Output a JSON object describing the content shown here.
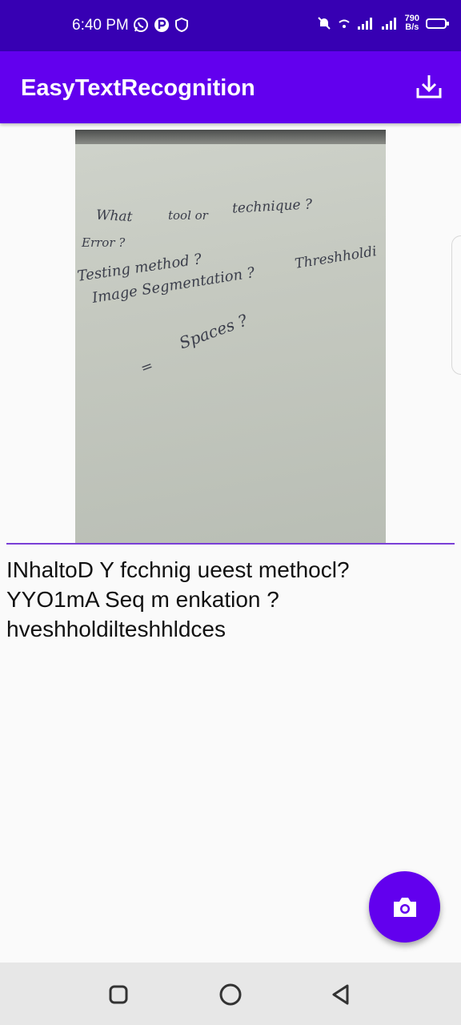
{
  "status_bar": {
    "time": "6:40 PM",
    "net_speed_value": "790",
    "net_speed_unit": "B/s",
    "icons": [
      "whatsapp-icon",
      "p-icon",
      "shield-icon",
      "mute-icon",
      "wifi-icon",
      "signal-icon",
      "signal-icon",
      "battery-icon"
    ]
  },
  "app_bar": {
    "title": "EasyTextRecognition",
    "action_icon": "download-icon"
  },
  "photo": {
    "handwriting": [
      "What",
      "tool  or",
      "technique ?",
      "Error ?",
      "Testing  method ?",
      "Image  Segmentation ?",
      "Threshholdi",
      "Spaces ?",
      "="
    ]
  },
  "result": {
    "text": "INhaltoD Y fcchnig ueest methocl?\nYYO1mA Seq m enkation ?\nhveshholdilteshhldces"
  },
  "fab": {
    "icon": "camera-icon"
  },
  "nav_bar": {
    "icons": [
      "recents-square-icon",
      "home-circle-icon",
      "back-triangle-icon"
    ]
  },
  "colors": {
    "status_bar": "#3700b3",
    "primary": "#6200ee",
    "background": "#fafafa",
    "nav_bar": "#e7e7e7"
  }
}
